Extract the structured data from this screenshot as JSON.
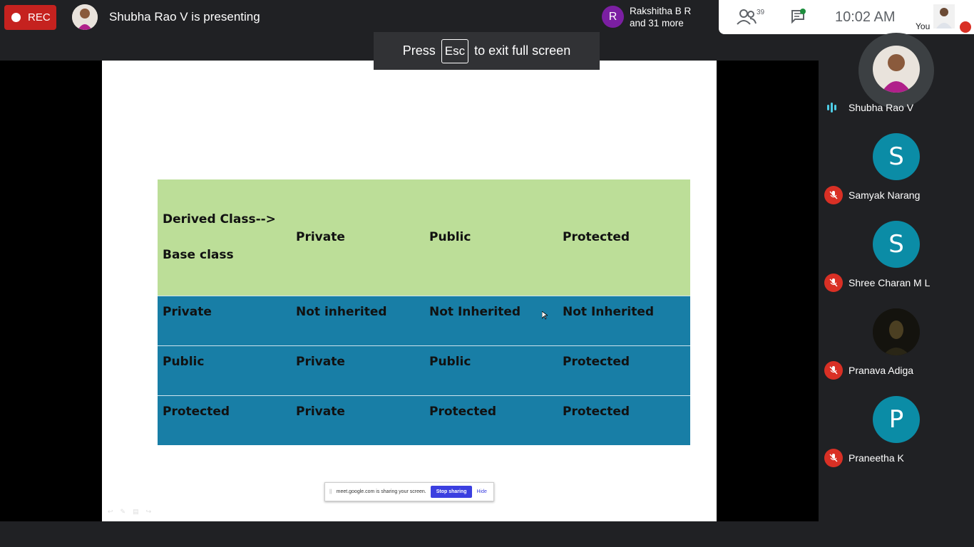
{
  "topbar": {
    "rec_label": "REC",
    "presenting_text": "Shubha Rao V is presenting",
    "raised": {
      "initial": "R",
      "line1": "Rakshitha B R",
      "line2": "and 31 more"
    },
    "people_count": "39",
    "time": "10:02  AM",
    "self_label": "You"
  },
  "esc_banner": {
    "before": "Press",
    "key": "Esc",
    "after": "to exit full screen"
  },
  "slide_table": {
    "header": {
      "first_line1": "Derived Class-->",
      "first_line2": "Base class",
      "c2": "Private",
      "c3": "Public",
      "c4": "Protected"
    },
    "rows": [
      [
        "Private",
        "Not inherited",
        "Not Inherited",
        "Not Inherited"
      ],
      [
        "Public",
        "Private",
        "Public",
        "Protected"
      ],
      [
        "Protected",
        "Private",
        "Protected",
        "Protected"
      ]
    ]
  },
  "share_bar": {
    "message": "meet.google.com is sharing your screen.",
    "stop": "Stop sharing",
    "hide": "Hide"
  },
  "participants": [
    {
      "name": "Shubha Rao V",
      "initial": "",
      "color": "#e9e3dc",
      "muted": false
    },
    {
      "name": "Samyak Narang",
      "initial": "S",
      "color": "#0b8ca6",
      "muted": true
    },
    {
      "name": "Shree Charan M L",
      "initial": "S",
      "color": "#0b8ca6",
      "muted": true
    },
    {
      "name": "Pranava Adiga",
      "initial": "",
      "color": "#1b1a14",
      "muted": true
    },
    {
      "name": "Praneetha K",
      "initial": "P",
      "color": "#0b8ca6",
      "muted": true
    }
  ],
  "colors": {
    "rec": "#c5221f",
    "header_green": "#bcde98",
    "body_blue": "#187ea6",
    "stop_button": "#3b3fe0"
  }
}
